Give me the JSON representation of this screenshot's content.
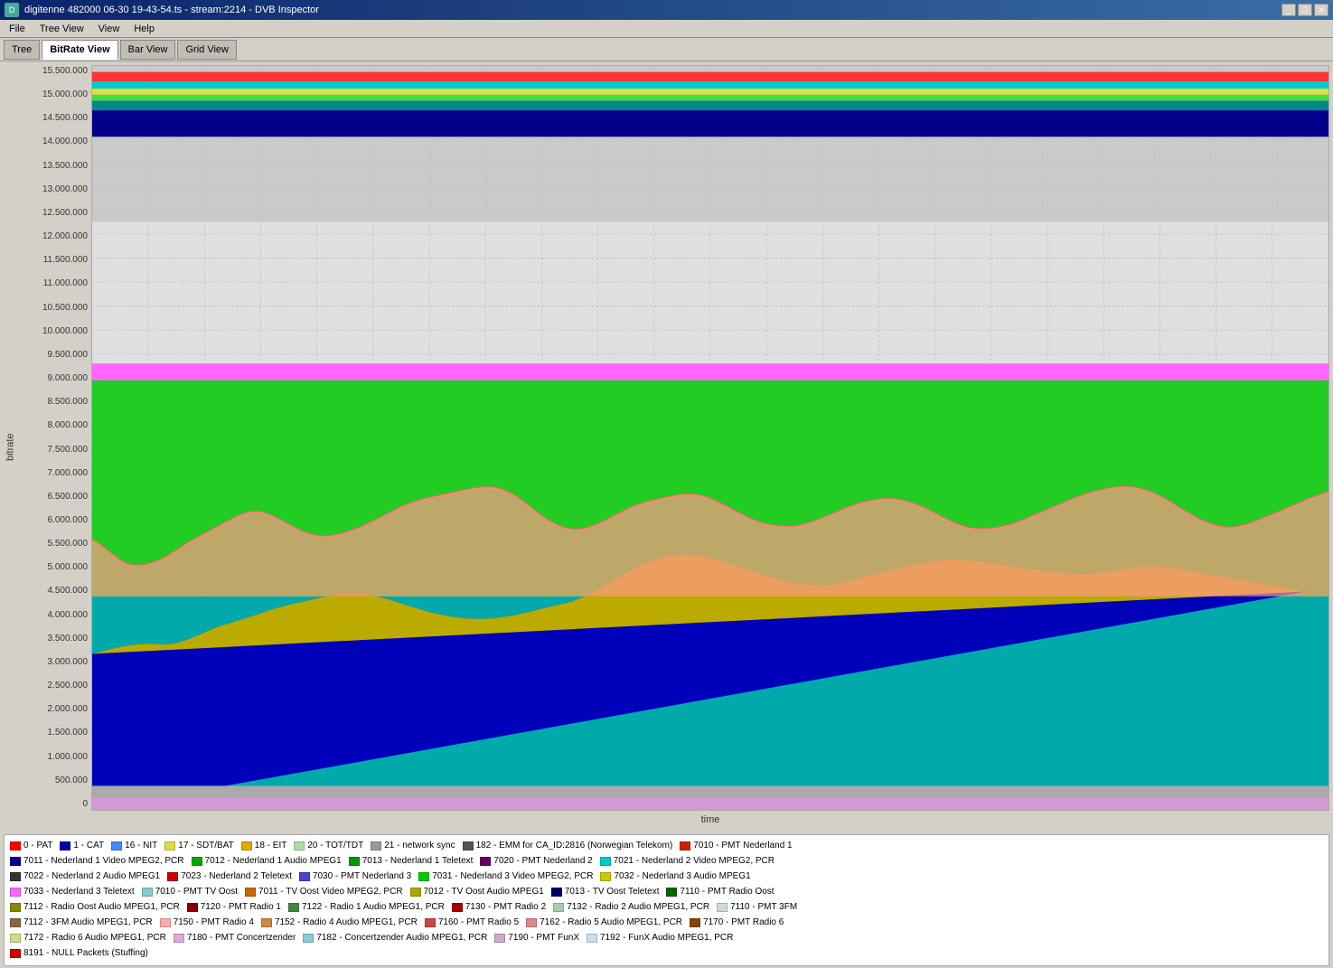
{
  "window": {
    "title": "digitenne 482000 06-30 19-43-54.ts - stream:2214 - DVB Inspector",
    "icon": "dvb"
  },
  "menu": {
    "items": [
      "File",
      "Tree View",
      "View",
      "Help"
    ]
  },
  "toolbar": {
    "tabs": [
      {
        "label": "Tree",
        "active": false
      },
      {
        "label": "BitRate View",
        "active": true
      },
      {
        "label": "Bar View",
        "active": false
      },
      {
        "label": "Grid View",
        "active": false
      }
    ]
  },
  "chart": {
    "y_label": "bitrate",
    "x_label": "time",
    "y_ticks": [
      "15.500.000",
      "15.000.000",
      "14.500.000",
      "14.000.000",
      "13.500.000",
      "13.000.000",
      "12.500.000",
      "12.000.000",
      "11.500.000",
      "11.000.000",
      "10.500.000",
      "10.000.000",
      "9.500.000",
      "9.000.000",
      "8.500.000",
      "8.000.000",
      "7.500.000",
      "7.000.000",
      "6.500.000",
      "6.000.000",
      "5.500.000",
      "5.000.000",
      "4.500.000",
      "4.000.000",
      "3.500.000",
      "3.000.000",
      "2.500.000",
      "2.000.000",
      "1.500.000",
      "1.000.000",
      "500.000",
      "0"
    ]
  },
  "legend": {
    "rows": [
      [
        {
          "color": "#ff0000",
          "label": "0 - PAT"
        },
        {
          "color": "#0000aa",
          "label": "1 - CAT"
        },
        {
          "color": "#4080ff",
          "label": "16 - NIT"
        },
        {
          "color": "#dddd00",
          "label": "17 - SDT/BAT"
        },
        {
          "color": "#ddaa00",
          "label": "18 - EIT"
        },
        {
          "color": "#aaddaa",
          "label": "20 - TOT/TDT"
        },
        {
          "color": "#888888",
          "label": "21 - network sync"
        },
        {
          "color": "#666666",
          "label": "182 - EMM for CA_ID:2816 (Norwegian Telekom)"
        },
        {
          "color": "#cc2200",
          "label": "7010 - PMT Nederland 1"
        }
      ],
      [
        {
          "color": "#000099",
          "label": "7011 - Nederland 1 Video MPEG2, PCR"
        },
        {
          "color": "#00aa00",
          "label": "7012 - Nederland 1 Audio MPEG1"
        },
        {
          "color": "#009900",
          "label": "7013 - Nederland 1 Teletext"
        },
        {
          "color": "#660066",
          "label": "7020 - PMT Nederland 2"
        },
        {
          "color": "#00cccc",
          "label": "7021 - Nederland 2 Video MPEG2, PCR"
        }
      ],
      [
        {
          "color": "#333333",
          "label": "7022 - Nederland 2 Audio MPEG1"
        },
        {
          "color": "#cc0000",
          "label": "7023 - Nederland 2 Teletext"
        },
        {
          "color": "#4444cc",
          "label": "7030 - PMT Nederland 3"
        },
        {
          "color": "#00cc00",
          "label": "7031 - Nederland 3 Video MPEG2, PCR"
        },
        {
          "color": "#cccc00",
          "label": "7032 - Nederland 3 Audio MPEG1"
        }
      ],
      [
        {
          "color": "#ff66ff",
          "label": "7033 - Nederland 3 Teletext"
        },
        {
          "color": "#88cccc",
          "label": "7010 - PMT TV Oost"
        },
        {
          "color": "#cc6600",
          "label": "7011 - TV Oost Video MPEG2, PCR"
        },
        {
          "color": "#aaaa00",
          "label": "7012 - TV Oost Audio MPEG1"
        },
        {
          "color": "#000066",
          "label": "7013 - TV Oost Teletext"
        },
        {
          "color": "#006600",
          "label": "7110 - PMT Radio Oost"
        }
      ],
      [
        {
          "color": "#888800",
          "label": "7112 - Radio Oost Audio MPEG1, PCR"
        },
        {
          "color": "#880000",
          "label": "7120 - PMT Radio 1"
        },
        {
          "color": "#448844",
          "label": "7122 - Radio 1 Audio MPEG1, PCR"
        },
        {
          "color": "#aa0000",
          "label": "7130 - PMT Radio 2"
        },
        {
          "color": "#aaccaa",
          "label": "7132 - Radio 2 Audio MPEG1, PCR"
        },
        {
          "color": "#ccddcc",
          "label": "7110 - PMT 3FM"
        }
      ],
      [
        {
          "color": "#886644",
          "label": "7112 - 3FM Audio MPEG1, PCR"
        },
        {
          "color": "#ffaaaa",
          "label": "7150 - PMT Radio 4"
        },
        {
          "color": "#cc8844",
          "label": "7152 - Radio 4 Audio MPEG1, PCR"
        },
        {
          "color": "#cc4444",
          "label": "7160 - PMT Radio 5"
        },
        {
          "color": "#dd8888",
          "label": "7162 - Radio 5 Audio MPEG1, PCR"
        },
        {
          "color": "#884400",
          "label": "7170 - PMT Radio 6"
        }
      ],
      [
        {
          "color": "#ccdd88",
          "label": "7172 - Radio 6 Audio MPEG1, PCR"
        },
        {
          "color": "#ddaadd",
          "label": "7180 - PMT Concertzender"
        },
        {
          "color": "#88ccdd",
          "label": "7182 - Concertzender Audio MPEG1, PCR"
        },
        {
          "color": "#ccaacc",
          "label": "7190 - PMT FunX"
        },
        {
          "color": "#ccddee",
          "label": "7192 - FunX Audio MPEG1, PCR"
        }
      ],
      [
        {
          "color": "#cc0000",
          "label": "8191 - NULL Packets (Stuffing)"
        }
      ]
    ]
  }
}
